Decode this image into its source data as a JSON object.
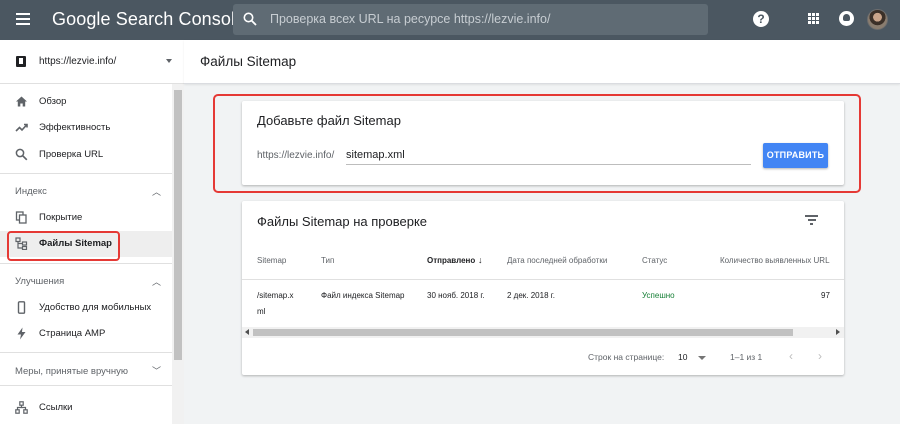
{
  "header": {
    "brand": "Google Search Console",
    "search_placeholder": "Проверка всех URL на ресурсе https://lezvie.info/"
  },
  "sidebar": {
    "property": "https://lezvie.info/",
    "items_top": [
      {
        "label": "Обзор",
        "icon": "home-icon"
      },
      {
        "label": "Эффективность",
        "icon": "trending-icon"
      },
      {
        "label": "Проверка URL",
        "icon": "search-icon"
      }
    ],
    "section_index": "Индекс",
    "items_index": [
      {
        "label": "Покрытие",
        "icon": "file-copy-icon"
      },
      {
        "label": "Файлы Sitemap",
        "icon": "sitemap-icon",
        "active": true
      }
    ],
    "section_improvements": "Улучшения",
    "items_improvements": [
      {
        "label": "Удобство для мобильных",
        "icon": "smartphone-icon"
      },
      {
        "label": "Страница AMP",
        "icon": "bolt-icon"
      }
    ],
    "section_manual": "Меры, принятые вручную",
    "items_bottom": [
      {
        "label": "Ссылки",
        "icon": "links-icon"
      }
    ]
  },
  "main": {
    "title": "Файлы Sitemap",
    "add_card": {
      "title": "Добавьте файл Sitemap",
      "prefix": "https://lezvie.info/",
      "input_value": "sitemap.xml",
      "submit_label": "ОТПРАВИТЬ"
    },
    "list_card": {
      "title": "Файлы Sitemap на проверке",
      "columns": [
        "Sitemap",
        "Тип",
        "Отправлено",
        "Дата последней обработки",
        "Статус",
        "Количество выявленных URL"
      ],
      "sort_arrow": "↓",
      "rows": [
        {
          "sitemap_line1": "/sitemap.x",
          "sitemap_line2": "ml",
          "type": "Файл индекса Sitemap",
          "submitted": "30 нояб. 2018 г.",
          "last_read": "2 дек. 2018 г.",
          "status": "Успешно",
          "urls": "97"
        }
      ],
      "pager": {
        "rows_label": "Строк на странице:",
        "rows_value": "10",
        "range": "1–1 из 1"
      }
    }
  },
  "colors": {
    "topbar": "#4b5761",
    "accent": "#4285f4",
    "success": "#188038",
    "highlight": "#e53935"
  }
}
